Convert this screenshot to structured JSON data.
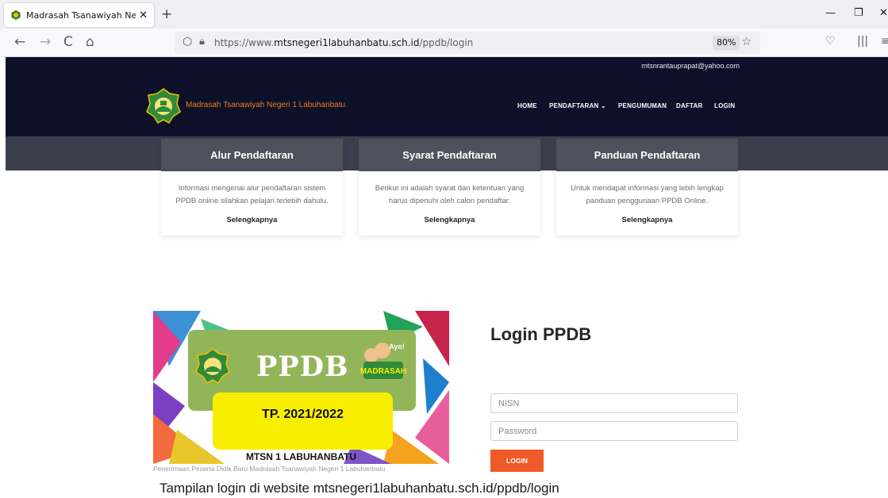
{
  "browser": {
    "tab_title": "Madrasah Tsanawiyah Negeri 1",
    "tab_close": "✕",
    "new_tab": "+",
    "back": "←",
    "forward": "→",
    "reload": "C",
    "home": "⌂",
    "url_prefix": "https://www.",
    "url_domain": "mtsnegeri1labuhanbatu.sch.id",
    "url_path": "/ppdb/login",
    "zoom": "80%",
    "icons": [
      "shield-icon",
      "lock-icon",
      "star-icon",
      "pocket-icon",
      "library-icon",
      "menu-icon"
    ]
  },
  "site": {
    "email": "mtsnrantauprapat@yahoo.com",
    "brand": "Madrasah Tsanawiyah Negeri 1 Labuhanbatu",
    "accent": "#f05a28",
    "nav": {
      "home": "HOME",
      "pendaftaran": "PENDAFTARAN ⌄",
      "pengumuman": "PENGUMUMAN",
      "daftar": "DAFTAR",
      "login": "LOGIN"
    }
  },
  "cards": [
    {
      "title": "Alur Pendaftaran",
      "text": "Informasi mengenai alur pendaftaran sistem PPDB online silahkan pelajari terlebih dahulu.",
      "link": "Selengkapnya"
    },
    {
      "title": "Syarat Pendaftaran",
      "text": "Berikut ini adalah syarat dan ketentuan yang harus dipenuhi oleh calon pendaftar.",
      "link": "Selengkapnya"
    },
    {
      "title": "Panduan Pendaftaran",
      "text": "Untuk mendapat informasi yang lebih lengkap panduan penggunaan PPDB Online.",
      "link": "Selengkapnya"
    }
  ],
  "banner": {
    "ppdb": "PPDB",
    "badge_top": "Ayo!",
    "badge_word": "MADRASAH",
    "year": "TP. 2021/2022",
    "school": "MTSN 1 LABUHANBATU",
    "caption": "Penerimaan Peserta Didik Baru Madrasah Tsanawiyah Negeri 1 Labuhanbatu"
  },
  "login": {
    "title": "Login PPDB",
    "nisn_placeholder": "NISN",
    "password_placeholder": "Password",
    "button": "LOGIN"
  },
  "caption": "Tampilan login di website mtsnegeri1labuhanbatu.sch.id/ppdb/login"
}
